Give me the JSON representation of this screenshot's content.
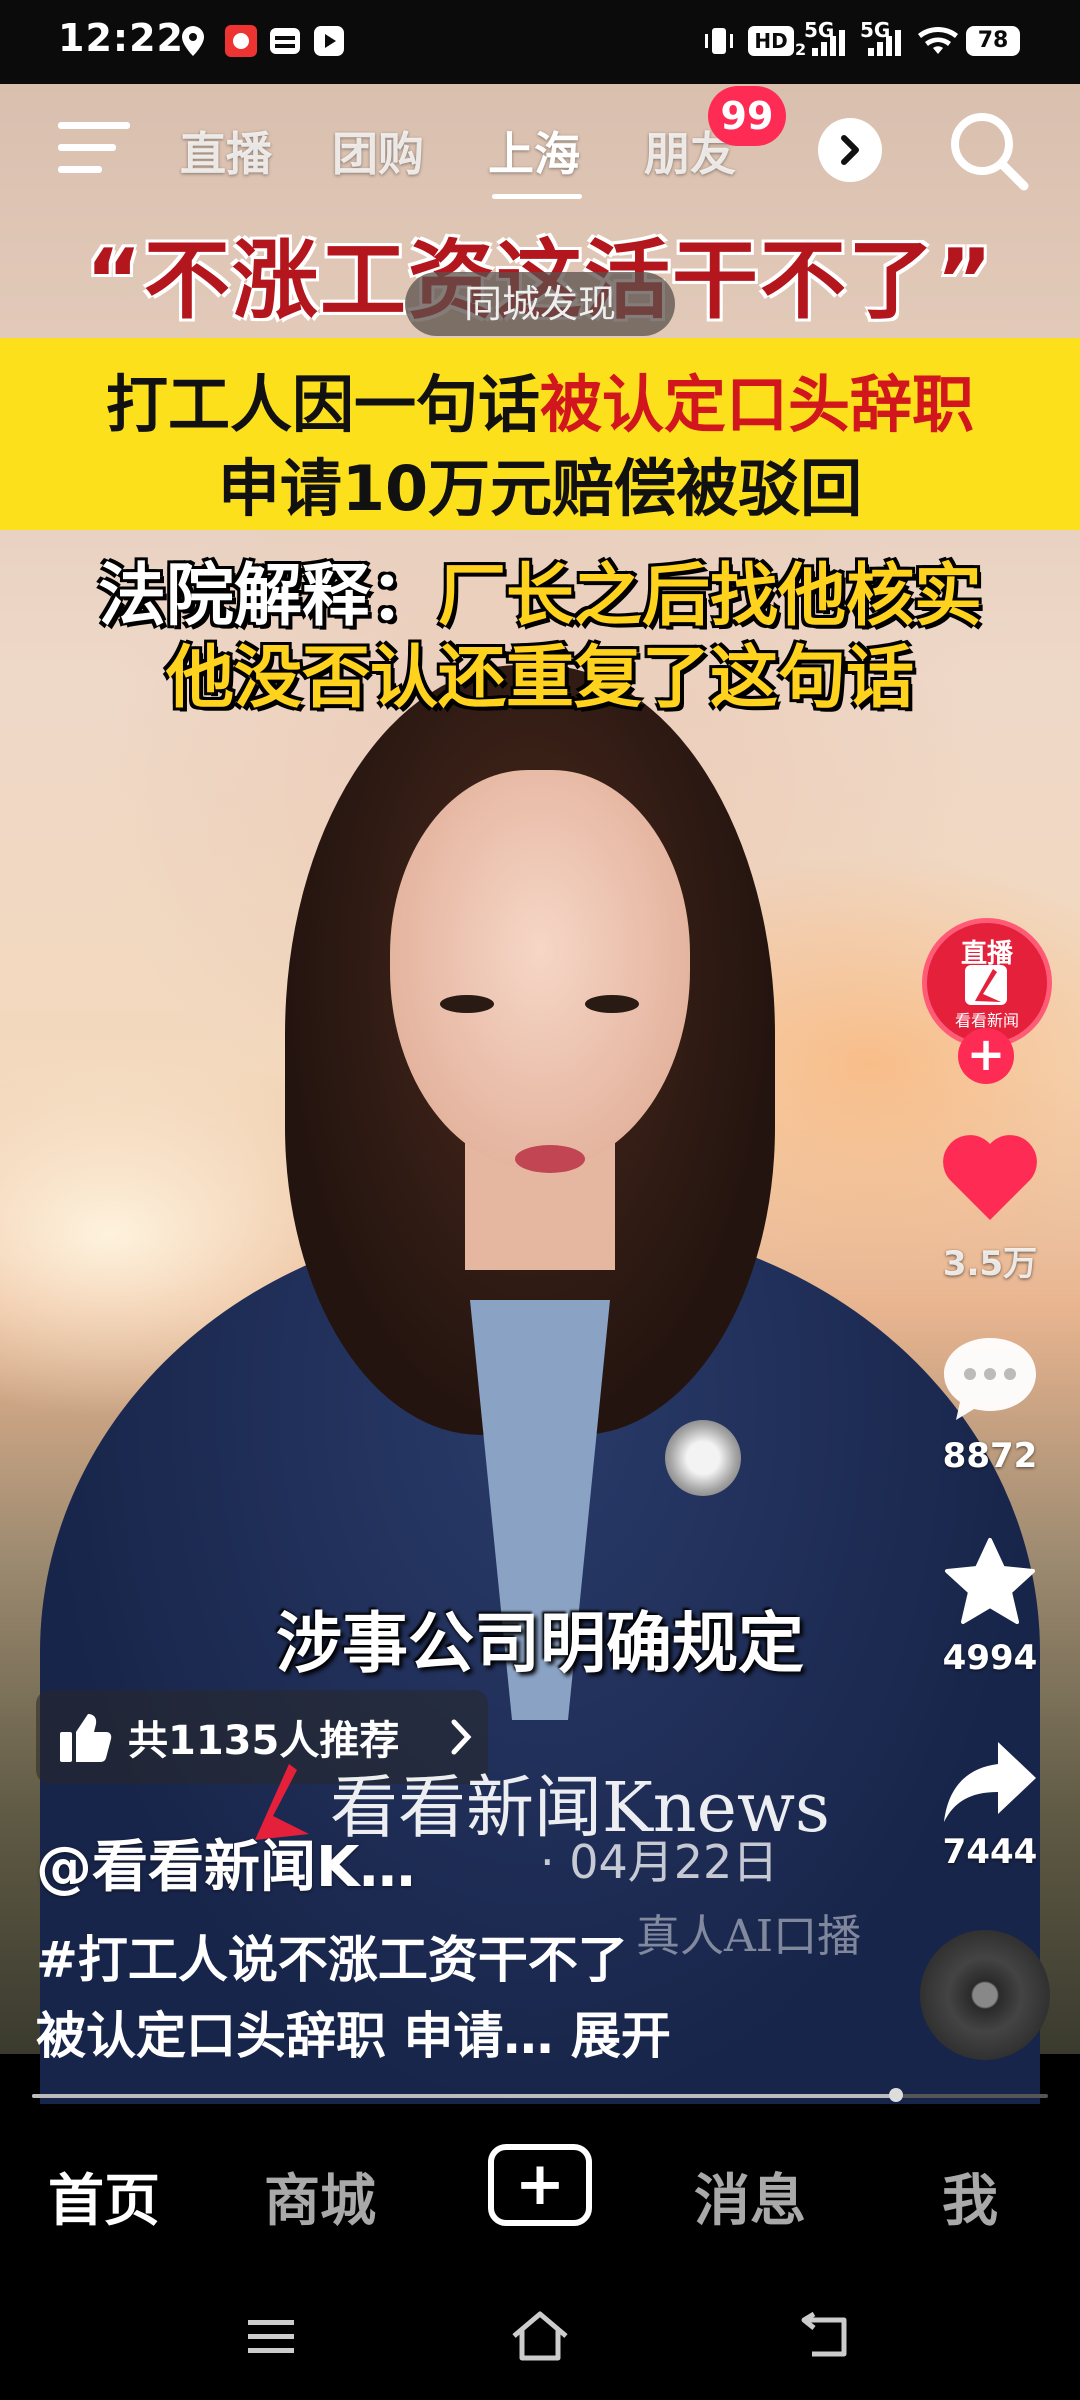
{
  "status_bar": {
    "time": "12:22",
    "indicators": [
      "location-icon",
      "app-icon",
      "card-icon",
      "play-icon",
      "vibrate-icon",
      "hd-icon",
      "5g-signal-icon",
      "5g-signal-icon",
      "wifi-icon"
    ],
    "hd_label": "HD",
    "hd_sub": "2",
    "net1": "5G",
    "net2": "5G",
    "battery": "78"
  },
  "top_nav": {
    "tabs": [
      "直播",
      "团购",
      "上海",
      "朋友"
    ],
    "active_tab": "上海",
    "badge": "99"
  },
  "video": {
    "headline_quote": "“不涨工资这活干不了”",
    "location_pill": "同城发现",
    "banner_line1_plain": "打工人因一句话",
    "banner_line1_red": "被认定口头辞职",
    "banner_line2": "申请10万元赔偿被驳回",
    "court_prefix": "法院解释：",
    "court_line1": "厂长之后找他核实",
    "court_line2": "他没否认还重复了这句话",
    "subtitle": "涉事公司明确规定",
    "watermark": "看看新闻Knews",
    "ai_watermark": "真人AI口播"
  },
  "right_rail": {
    "avatar_live": "直播",
    "avatar_name": "看看新闻",
    "likes": "3.5万",
    "comments": "8872",
    "favorites": "4994",
    "shares": "7444"
  },
  "info": {
    "recommend": "共1135人推荐",
    "author": "@看看新闻K…",
    "date": "· 04月22日",
    "desc_line1": "#打工人说不涨工资干不了",
    "desc_line2": "被认定口头辞职 申请…",
    "expand": "展开"
  },
  "progress": {
    "fraction": 0.85
  },
  "bottom_tabs": {
    "home": "首页",
    "mall": "商城",
    "messages": "消息",
    "me": "我"
  }
}
